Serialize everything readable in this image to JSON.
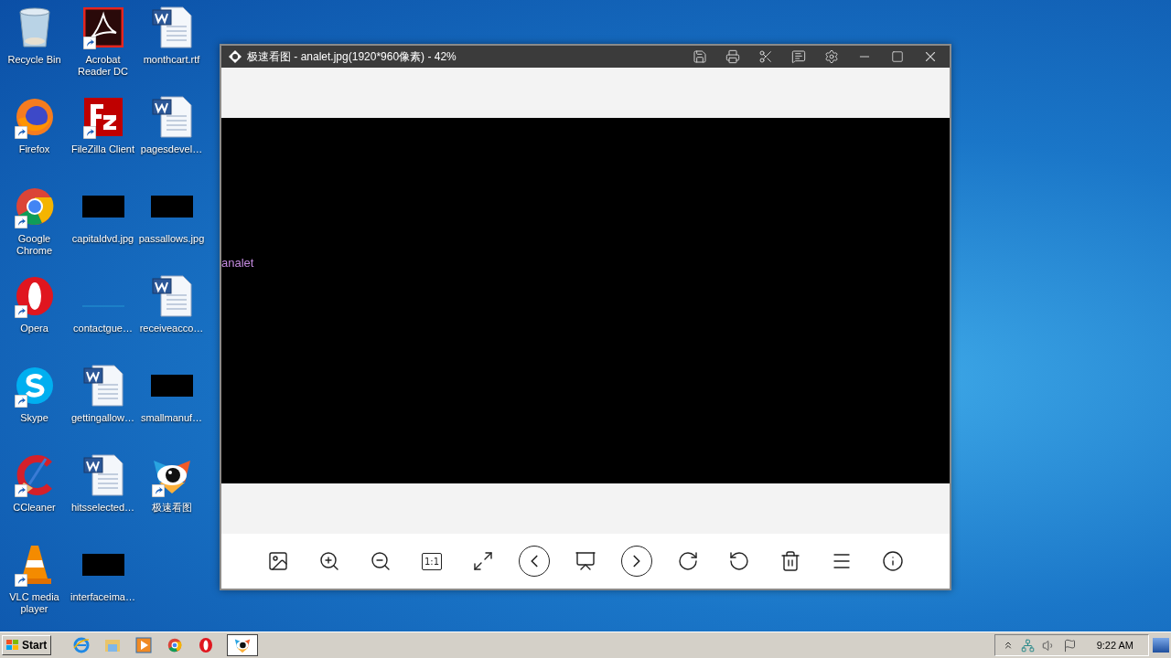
{
  "desktop": {
    "icons": [
      {
        "label": "Recycle Bin",
        "kind": "recycle",
        "shortcut": false
      },
      {
        "label": "Firefox",
        "kind": "firefox",
        "shortcut": true
      },
      {
        "label": "Google\nChrome",
        "kind": "chrome",
        "shortcut": true
      },
      {
        "label": "Opera",
        "kind": "opera",
        "shortcut": true
      },
      {
        "label": "Skype",
        "kind": "skype",
        "shortcut": true
      },
      {
        "label": "CCleaner",
        "kind": "ccleaner",
        "shortcut": true
      },
      {
        "label": "VLC media\nplayer",
        "kind": "vlc",
        "shortcut": true
      },
      {
        "label": "Acrobat\nReader DC",
        "kind": "acrobat",
        "shortcut": true
      },
      {
        "label": "FileZilla Client",
        "kind": "filezilla",
        "shortcut": true
      },
      {
        "label": "capitaldvd.jpg",
        "kind": "image",
        "shortcut": false
      },
      {
        "label": "contactgue…",
        "kind": "blank",
        "shortcut": false
      },
      {
        "label": "gettingallow…",
        "kind": "word",
        "shortcut": false
      },
      {
        "label": "hitsselected…",
        "kind": "word",
        "shortcut": false
      },
      {
        "label": "interfaceima…",
        "kind": "image",
        "shortcut": false
      },
      {
        "label": "monthcart.rtf",
        "kind": "word",
        "shortcut": false
      },
      {
        "label": "pagesdevel…",
        "kind": "word",
        "shortcut": false
      },
      {
        "label": "passallows.jpg",
        "kind": "image",
        "shortcut": false
      },
      {
        "label": "receiveacco…",
        "kind": "word",
        "shortcut": false
      },
      {
        "label": "smallmanuf…",
        "kind": "image",
        "shortcut": false
      },
      {
        "label": "极速看图",
        "kind": "viewer",
        "shortcut": true
      }
    ]
  },
  "window": {
    "title": "极速看图 - analet.jpg(1920*960像素) - 42%",
    "title_buttons": [
      {
        "kind": "save"
      },
      {
        "kind": "print"
      },
      {
        "kind": "cut"
      },
      {
        "kind": "note"
      },
      {
        "kind": "settings"
      },
      {
        "kind": "minimize"
      },
      {
        "kind": "maximize"
      },
      {
        "kind": "close"
      }
    ],
    "image_alt": "analet",
    "toolbar": [
      {
        "kind": "image"
      },
      {
        "kind": "zoom_in"
      },
      {
        "kind": "zoom_out"
      },
      {
        "kind": "actual_size",
        "label": "1:1"
      },
      {
        "kind": "fit"
      },
      {
        "kind": "previous"
      },
      {
        "kind": "slideshow"
      },
      {
        "kind": "next"
      },
      {
        "kind": "rotate_cw"
      },
      {
        "kind": "rotate_ccw"
      },
      {
        "kind": "delete"
      },
      {
        "kind": "menu"
      },
      {
        "kind": "info"
      }
    ]
  },
  "taskbar": {
    "start": "Start",
    "apps": [
      {
        "kind": "ie",
        "selected": false
      },
      {
        "kind": "explorer",
        "selected": false
      },
      {
        "kind": "media",
        "selected": false
      },
      {
        "kind": "chrome",
        "selected": false
      },
      {
        "kind": "opera",
        "selected": false
      },
      {
        "kind": "viewer",
        "selected": true
      }
    ],
    "tray": [
      {
        "kind": "expand"
      },
      {
        "kind": "network"
      },
      {
        "kind": "volume"
      },
      {
        "kind": "flag"
      }
    ],
    "clock": "9:22 AM"
  }
}
